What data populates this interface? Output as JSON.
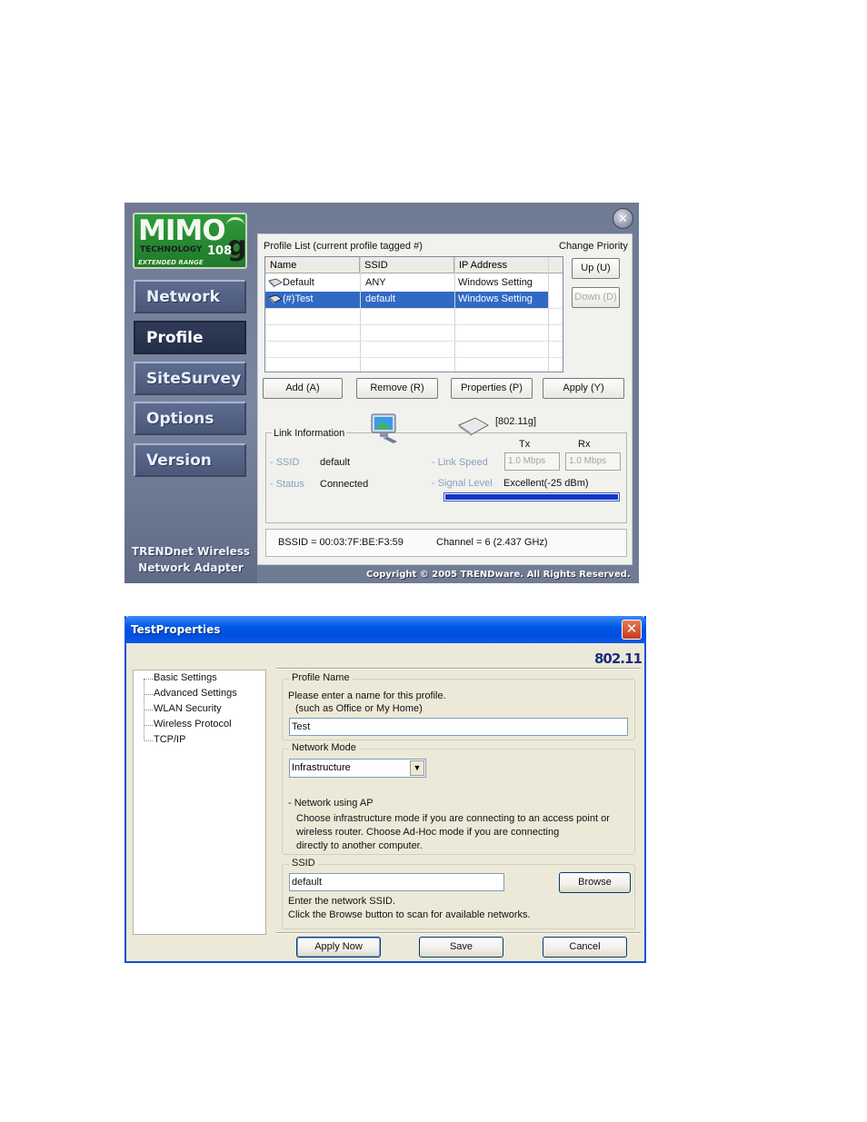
{
  "utility": {
    "logo": {
      "brand": "MIMO",
      "sub": "TECHNOLOGY",
      "speed": "108",
      "speed_unit": "Mbps",
      "band": "g",
      "tagline": "EXTENDED RANGE"
    },
    "nav": [
      {
        "label": "Network",
        "active": false
      },
      {
        "label": "Profile",
        "active": true
      },
      {
        "label": "SiteSurvey",
        "active": false
      },
      {
        "label": "Options",
        "active": false
      },
      {
        "label": "Version",
        "active": false
      }
    ],
    "brand_line1": "TRENDnet Wireless",
    "brand_line2": "Network Adapter",
    "profile_list_label": "Profile List (current profile tagged #)",
    "change_priority_label": "Change Priority",
    "columns": [
      "Name",
      "SSID",
      "IP Address"
    ],
    "profiles": [
      {
        "name": "Default",
        "ssid": "ANY",
        "ip": "Windows Setting",
        "selected": false
      },
      {
        "name": "(#)Test",
        "ssid": "default",
        "ip": "Windows Setting",
        "selected": true
      }
    ],
    "up_button": "Up (U)",
    "down_button": "Down (D)",
    "add_button": "Add (A)",
    "remove_button": "Remove (R)",
    "properties_button": "Properties (P)",
    "apply_button": "Apply (Y)",
    "link_info_label": "Link Information",
    "mode_tag": "[802.11g]",
    "tx_label": "Tx",
    "rx_label": "Rx",
    "ssid_label": "- SSID",
    "ssid_value": "default",
    "status_label": "- Status",
    "status_value": "Connected",
    "link_speed_label": "- Link Speed",
    "tx_speed": "1.0 Mbps",
    "rx_speed": "1.0 Mbps",
    "signal_label": "- Signal Level",
    "signal_value": "Excellent(-25 dBm)",
    "signal_fraction": 1.0,
    "bssid": "BSSID = 00:03:7F:BE:F3:59",
    "channel": "Channel = 6 (2.437 GHz)",
    "copyright": "Copyright © 2005 TRENDware. All Rights Reserved."
  },
  "dialog": {
    "title": "TestProperties",
    "standard": "802.11",
    "tree": [
      "Basic Settings",
      "Advanced Settings",
      "WLAN Security",
      "Wireless Protocol",
      "TCP/IP"
    ],
    "profile_name_group": "Profile Name",
    "profile_name_help1": "Please enter a name for this profile.",
    "profile_name_help2": "(such as Office or My Home)",
    "profile_name_value": "Test",
    "network_mode_group": "Network Mode",
    "network_mode_value": "Infrastructure",
    "network_mode_caption": "- Network using AP",
    "network_mode_desc1": "Choose infrastructure mode if you are connecting to an access point or",
    "network_mode_desc2": "wireless router. Choose Ad-Hoc mode if you are connecting",
    "network_mode_desc3": "directly to another computer.",
    "ssid_group": "SSID",
    "ssid_value": "default",
    "browse_button": "Browse",
    "ssid_help1": "Enter the network SSID.",
    "ssid_help2": "Click the Browse button to scan for available networks.",
    "apply_now_button": "Apply Now",
    "save_button": "Save",
    "cancel_button": "Cancel"
  }
}
